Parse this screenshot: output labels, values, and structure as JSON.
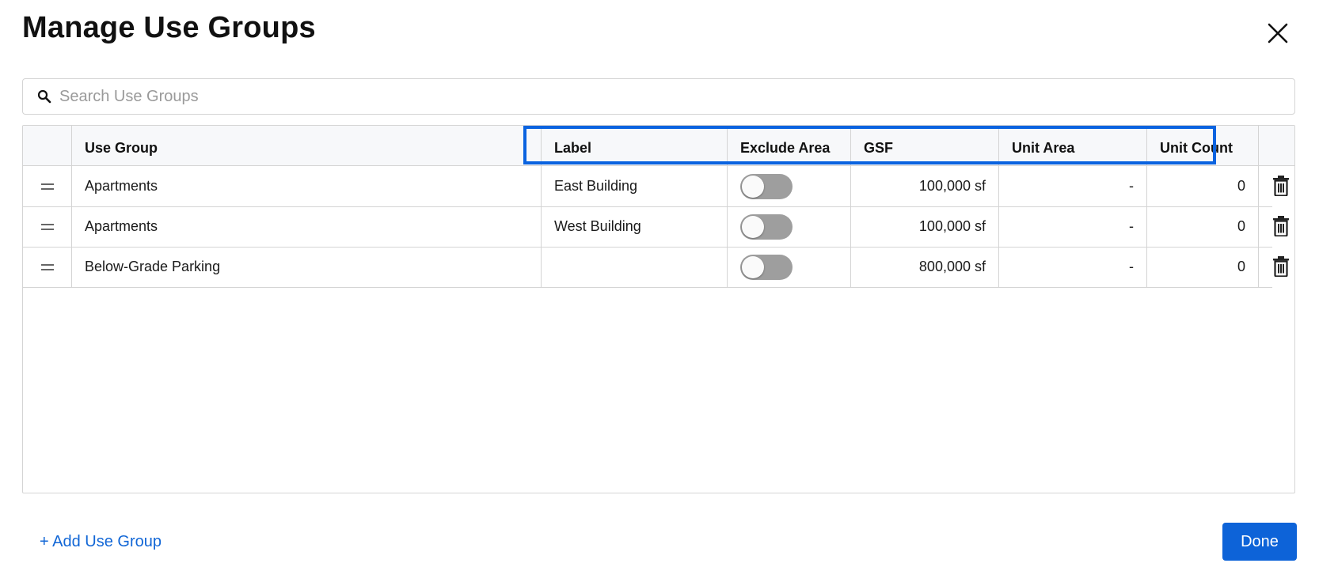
{
  "dialog": {
    "title": "Manage Use Groups",
    "close_icon": "close-icon"
  },
  "search": {
    "placeholder": "Search Use Groups",
    "value": "",
    "icon": "search-icon"
  },
  "table": {
    "columns": {
      "use_group": "Use Group",
      "label": "Label",
      "exclude_area": "Exclude Area",
      "gsf": "GSF",
      "unit_area": "Unit Area",
      "unit_count": "Unit Count"
    },
    "rows": [
      {
        "use_group": "Apartments",
        "label": "East Building",
        "exclude_area": false,
        "gsf": "100,000 sf",
        "unit_area": "-",
        "unit_count": "0"
      },
      {
        "use_group": "Apartments",
        "label": "West Building",
        "exclude_area": false,
        "gsf": "100,000 sf",
        "unit_area": "-",
        "unit_count": "0"
      },
      {
        "use_group": "Below-Grade Parking",
        "label": "",
        "exclude_area": false,
        "gsf": "800,000 sf",
        "unit_area": "-",
        "unit_count": "0"
      }
    ],
    "row_icons": {
      "drag": "drag-handle-icon",
      "delete": "trash-icon"
    }
  },
  "footer": {
    "add_label": "+ Add Use Group",
    "done_label": "Done"
  },
  "colors": {
    "accent": "#0d63d8",
    "highlight": "#0a63e0",
    "toggle_off": "#9e9e9e",
    "header_bg": "#f7f8fa"
  }
}
